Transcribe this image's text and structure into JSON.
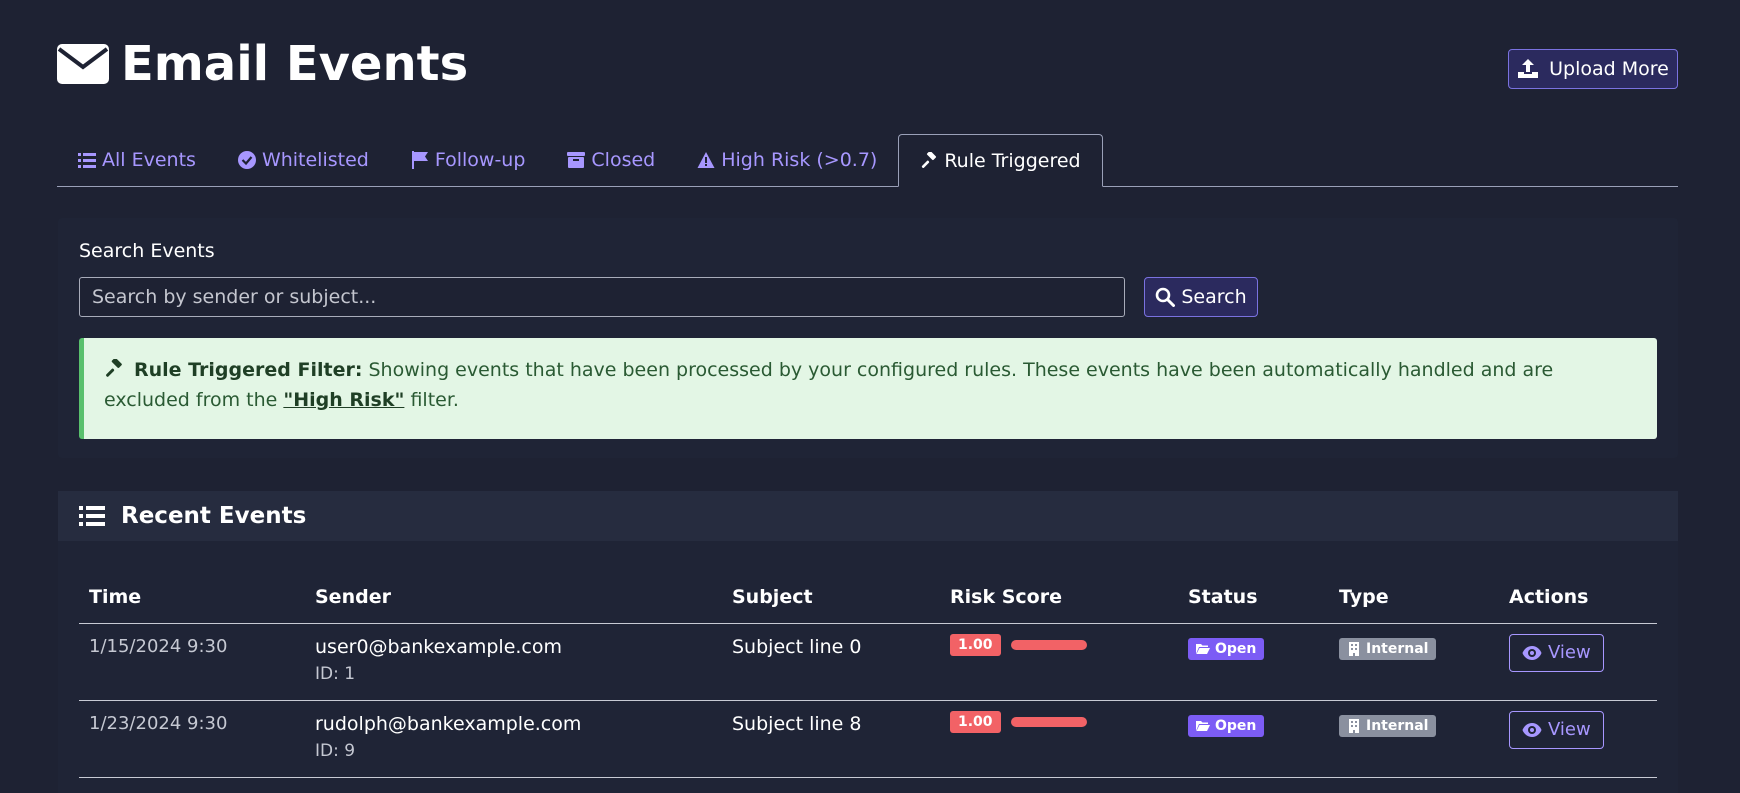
{
  "header": {
    "title": "Email Events",
    "upload_label": "Upload More"
  },
  "tabs": [
    {
      "label": "All Events",
      "icon": "list-icon"
    },
    {
      "label": "Whitelisted",
      "icon": "check-circle-icon"
    },
    {
      "label": "Follow-up",
      "icon": "flag-icon"
    },
    {
      "label": "Closed",
      "icon": "archive-icon"
    },
    {
      "label": "High Risk (>0.7)",
      "icon": "warning-icon"
    },
    {
      "label": "Rule Triggered",
      "icon": "gavel-icon",
      "active": true
    }
  ],
  "search": {
    "label": "Search Events",
    "placeholder": "Search by sender or subject...",
    "button_label": "Search"
  },
  "alert": {
    "title": "Rule Triggered Filter:",
    "text_before": " Showing events that have been processed by your configured rules. These events have been automatically handled and are excluded from the ",
    "link": "\"High Risk\"",
    "text_after": " filter."
  },
  "events": {
    "title": "Recent Events",
    "columns": [
      "Time",
      "Sender",
      "Subject",
      "Risk Score",
      "Status",
      "Type",
      "Actions"
    ],
    "rows": [
      {
        "time": "1/15/2024 9:30",
        "sender": "user0@bankexample.com",
        "id": "ID: 1",
        "subject": "Subject line 0",
        "risk": "1.00",
        "status": "Open",
        "type": "Internal",
        "action": "View"
      },
      {
        "time": "1/23/2024 9:30",
        "sender": "rudolph@bankexample.com",
        "id": "ID: 9",
        "subject": "Subject line 8",
        "risk": "1.00",
        "status": "Open",
        "type": "Internal",
        "action": "View"
      }
    ]
  },
  "colors": {
    "background": "#1e2233",
    "accent": "#a797ff",
    "risk_high": "#f26266",
    "status_open": "#7c5cf5",
    "type_internal": "#8a909f",
    "alert_bg": "#e3f6e5"
  }
}
